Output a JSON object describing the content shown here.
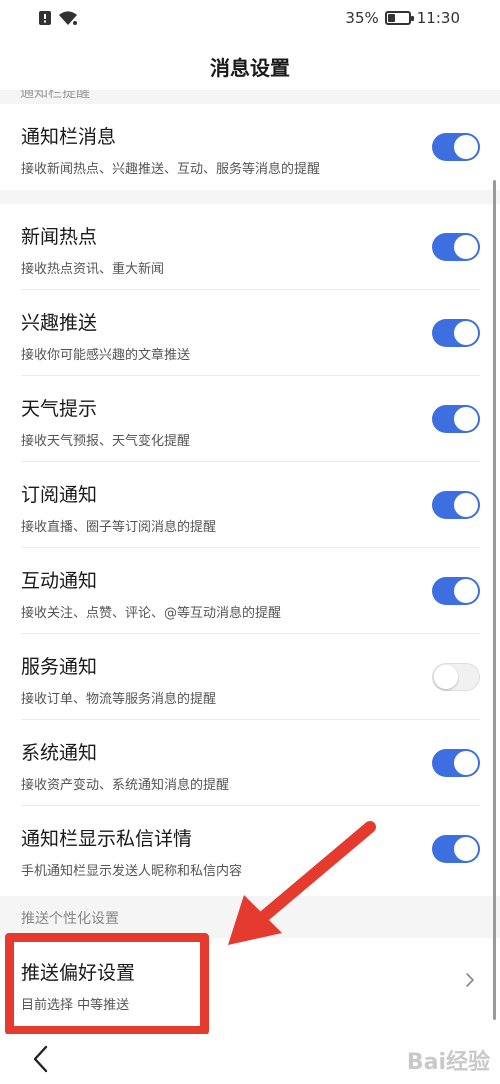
{
  "status_bar": {
    "battery_percent": "35%",
    "battery_level": 0.35,
    "time": "11:30"
  },
  "header": {
    "title": "消息设置"
  },
  "cut_section_label": "通知栏提醒",
  "rows": [
    {
      "title": "通知栏消息",
      "subtitle": "接收新闻热点、兴趣推送、互动、服务等消息的提醒",
      "enabled": true
    },
    {
      "title": "新闻热点",
      "subtitle": "接收热点资讯、重大新闻",
      "enabled": true
    },
    {
      "title": "兴趣推送",
      "subtitle": "接收你可能感兴趣的文章推送",
      "enabled": true
    },
    {
      "title": "天气提示",
      "subtitle": "接收天气预报、天气变化提醒",
      "enabled": true
    },
    {
      "title": "订阅通知",
      "subtitle": "接收直播、圈子等订阅消息的提醒",
      "enabled": true
    },
    {
      "title": "互动通知",
      "subtitle": "接收关注、点赞、评论、@等互动消息的提醒",
      "enabled": true
    },
    {
      "title": "服务通知",
      "subtitle": "接收订单、物流等服务消息的提醒",
      "enabled": false
    },
    {
      "title": "系统通知",
      "subtitle": "接收资产变动、系统通知消息的提醒",
      "enabled": true
    },
    {
      "title": "通知栏显示私信详情",
      "subtitle": "手机通知栏显示发送人昵称和私信内容",
      "enabled": true
    }
  ],
  "push_section": {
    "header": "推送个性化设置",
    "preference": {
      "title": "推送偏好设置",
      "subtitle": "目前选择 中等推送"
    }
  },
  "watermark": "Bai经验",
  "colors": {
    "toggle_on": "#3d6fe0",
    "annotation_red": "#e53a2e"
  },
  "icons": {
    "wifi": "wifi-icon",
    "alert": "alert-icon",
    "battery": "battery-icon",
    "chevron": "chevron-right-icon",
    "back": "back-arrow-icon"
  }
}
